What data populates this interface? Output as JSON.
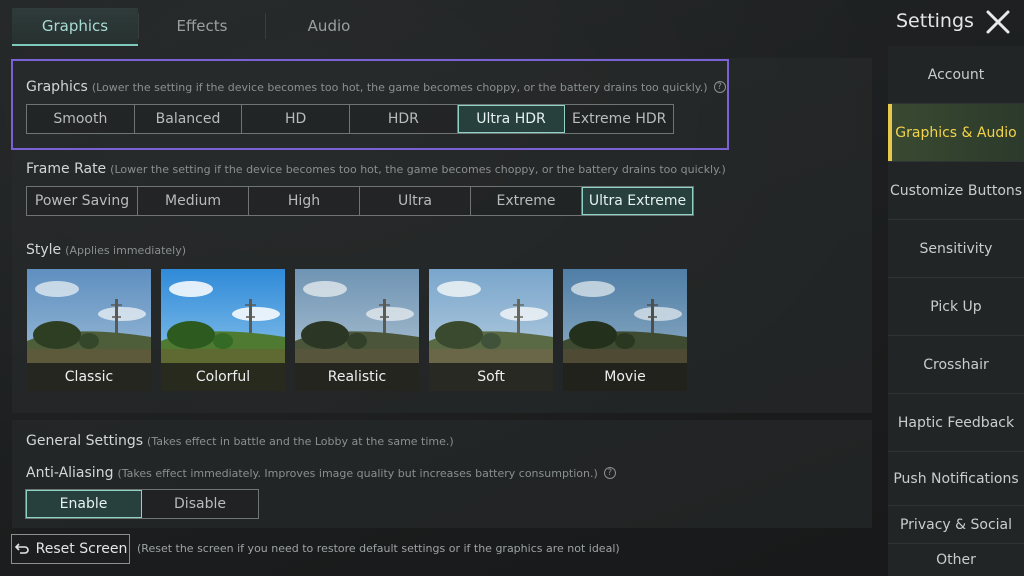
{
  "tabs": [
    {
      "label": "Graphics",
      "active": true
    },
    {
      "label": "Effects",
      "active": false
    },
    {
      "label": "Audio",
      "active": false
    }
  ],
  "header": {
    "title": "Settings",
    "close_icon": "close-icon"
  },
  "graphics": {
    "label": "Graphics",
    "note": "(Lower the setting if the device becomes too hot, the game becomes choppy, or the battery drains too quickly.)",
    "options": [
      "Smooth",
      "Balanced",
      "HD",
      "HDR",
      "Ultra HDR",
      "Extreme HDR"
    ],
    "selected": "Ultra HDR"
  },
  "frame_rate": {
    "label": "Frame Rate",
    "note": "(Lower the setting if the device becomes too hot, the game becomes choppy, or the battery drains too quickly.)",
    "options": [
      "Power Saving",
      "Medium",
      "High",
      "Ultra",
      "Extreme",
      "Ultra Extreme"
    ],
    "selected": "Ultra Extreme"
  },
  "style": {
    "label": "Style",
    "note": "(Applies immediately)",
    "options": [
      "Classic",
      "Colorful",
      "Realistic",
      "Soft",
      "Movie"
    ],
    "selected": "Classic"
  },
  "general": {
    "label": "General Settings",
    "note": "(Takes effect in battle and the Lobby at the same time.)"
  },
  "anti_aliasing": {
    "label": "Anti-Aliasing",
    "note": "(Takes effect immediately. Improves image quality but increases battery consumption.)",
    "options": [
      "Enable",
      "Disable"
    ],
    "selected": "Enable"
  },
  "reset": {
    "label": "Reset Screen",
    "note": "(Reset the screen if you need to restore default settings or if the graphics are not ideal)"
  },
  "sidebar": {
    "items": [
      {
        "label": "Account",
        "active": false
      },
      {
        "label": "Graphics & Audio",
        "active": true
      },
      {
        "label": "Customize Buttons",
        "active": false
      },
      {
        "label": "Sensitivity",
        "active": false
      },
      {
        "label": "Pick Up",
        "active": false
      },
      {
        "label": "Crosshair",
        "active": false
      },
      {
        "label": "Haptic Feedback",
        "active": false
      },
      {
        "label": "Push Notifications",
        "active": false
      },
      {
        "label": "Privacy & Social",
        "active": false
      },
      {
        "label": "Other",
        "active": false
      }
    ]
  },
  "colors": {
    "accent": "#8fd3c6",
    "highlight": "#7a62d6",
    "selected_style": "#e8c84a",
    "sidebar_active_text": "#f2d34a"
  }
}
